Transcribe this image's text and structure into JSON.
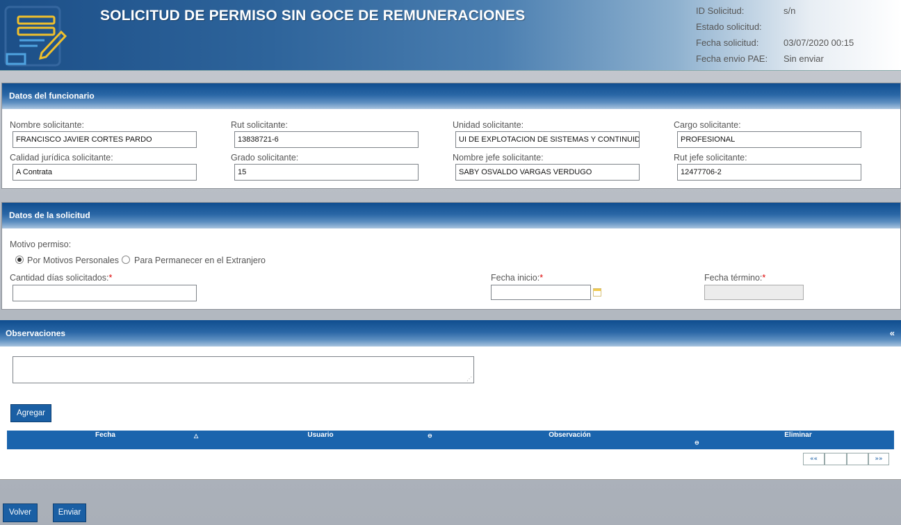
{
  "header": {
    "title": "SOLICITUD DE PERMISO SIN GOCE DE REMUNERACIONES",
    "meta": [
      {
        "label": "ID Solicitud:",
        "value": "s/n"
      },
      {
        "label": "Estado solicitud:",
        "value": ""
      },
      {
        "label": "Fecha solicitud:",
        "value": "03/07/2020 00:15"
      },
      {
        "label": "Fecha envio PAE:",
        "value": "Sin enviar"
      }
    ]
  },
  "funcionario": {
    "title": "Datos del funcionario",
    "nombre_label": "Nombre solicitante:",
    "nombre_value": "FRANCISCO JAVIER CORTES PARDO",
    "rut_label": "Rut solicitante:",
    "rut_value": "13838721-6",
    "unidad_label": "Unidad solicitante:",
    "unidad_value": "UI DE EXPLOTACION DE SISTEMAS Y CONTINUIDAD",
    "cargo_label": "Cargo solicitante:",
    "cargo_value": "PROFESIONAL",
    "calidad_label": "Calidad jurídica solicitante:",
    "calidad_value": "A Contrata",
    "grado_label": "Grado solicitante:",
    "grado_value": "15",
    "jefe_label": "Nombre jefe solicitante:",
    "jefe_value": "SABY OSVALDO VARGAS VERDUGO",
    "rut_jefe_label": "Rut jefe solicitante:",
    "rut_jefe_value": "12477706-2"
  },
  "solicitud": {
    "title": "Datos de la solicitud",
    "motivo_label": "Motivo permiso:",
    "motivo_options": [
      "Por Motivos Personales",
      "Para Permanecer en el Extranjero"
    ],
    "motivo_selected": "Por Motivos Personales",
    "dias_label": "Cantidad días solicitados:",
    "dias_value": "",
    "fecha_inicio_label": "Fecha inicio:",
    "fecha_inicio_value": "",
    "fecha_termino_label": "Fecha término:",
    "fecha_termino_value": "",
    "required_mark": "*"
  },
  "observaciones": {
    "title": "Observaciones",
    "collapse_glyph": "«",
    "textarea_value": "",
    "add_button": "Agregar",
    "columns": [
      "Fecha",
      "Usuario",
      "Observación",
      "Eliminar"
    ],
    "pager": {
      "first": "««",
      "last": "»»"
    }
  },
  "footer": {
    "back_button": "Volver",
    "send_button": "Enviar"
  },
  "icons": {
    "logo": "form-edit-icon",
    "calendar": "calendar-icon",
    "sort_asc": "sort-asc-icon",
    "sort_none": "sort-icon",
    "resize": "resize-grip-icon"
  },
  "colors": {
    "panel_header": "#1a64ad",
    "button": "#1a5fa4",
    "required": "#dd0000"
  }
}
